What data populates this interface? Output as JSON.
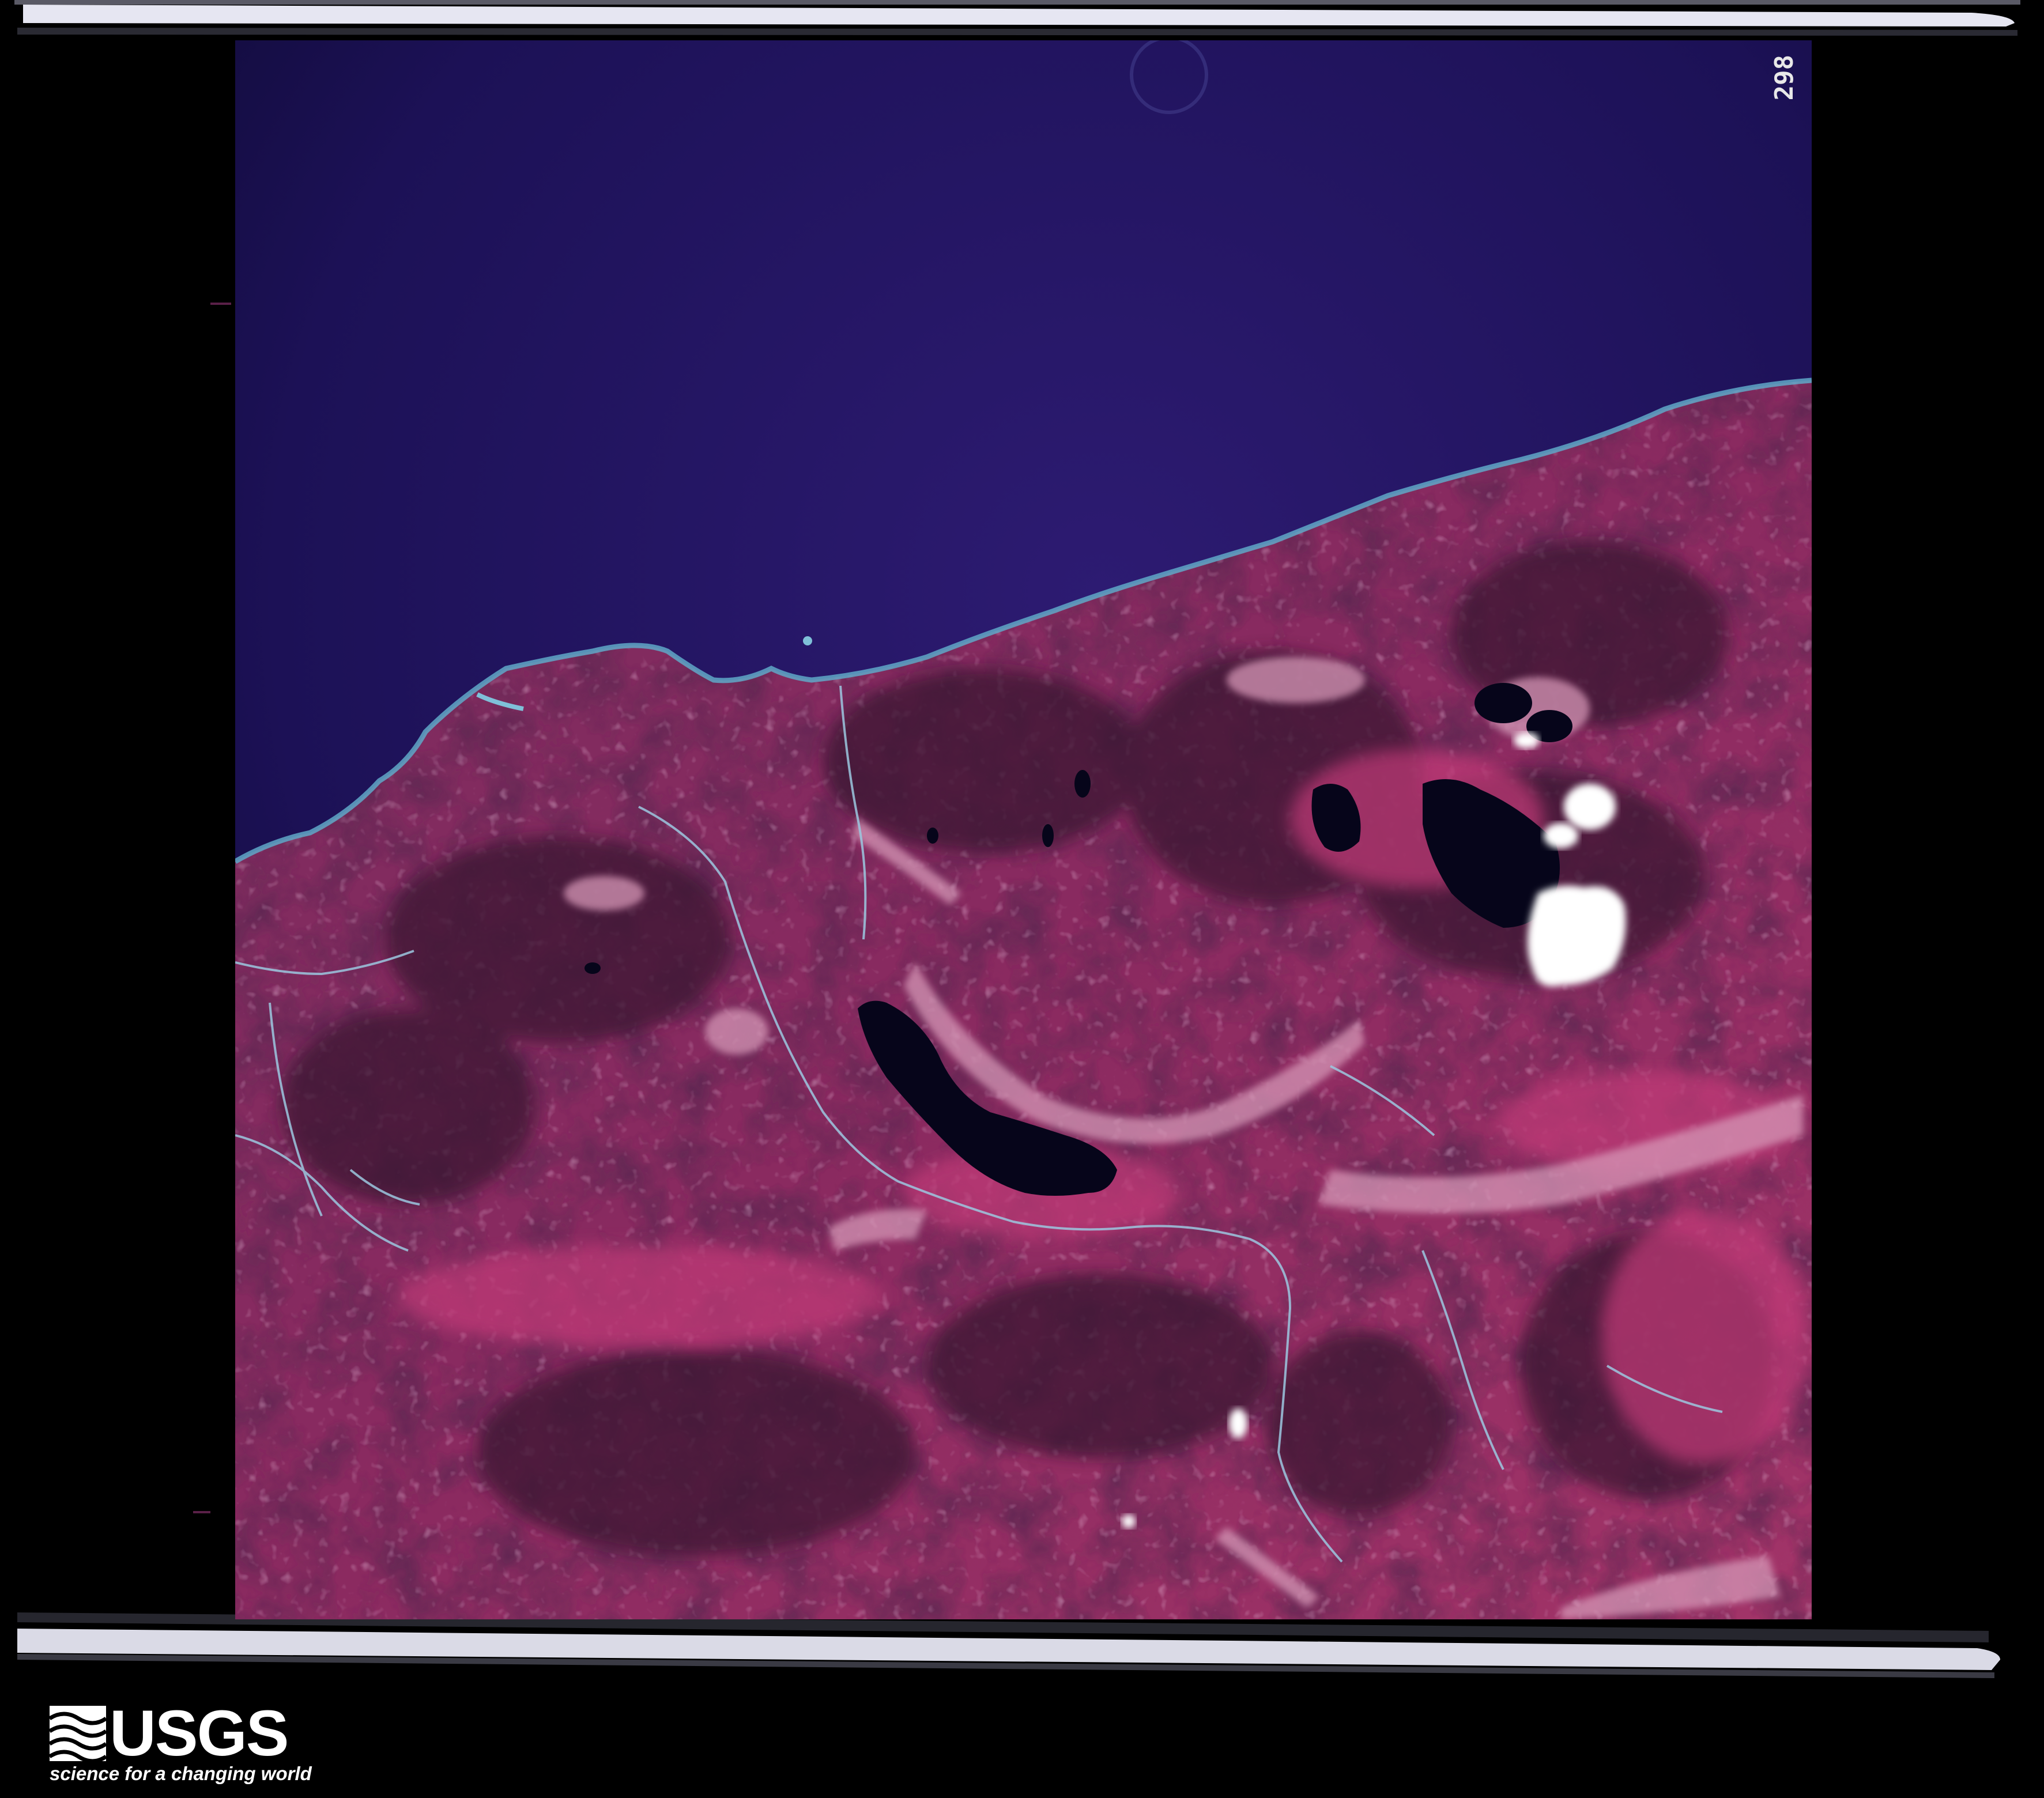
{
  "image": {
    "frame_number": "298",
    "scene": "false-color infrared aerial photograph of a coastline with lakes and mountainous terrain"
  },
  "logo": {
    "wordmark": "USGS",
    "tagline": "science for a changing world"
  },
  "colors": {
    "sea": "#1e125a",
    "land": "#8a2c62",
    "land_dark": "#3d1532",
    "land_bright": "#c0487a",
    "lake": "#07061a",
    "cloud": "#ffffff",
    "film_border": "#000000"
  }
}
